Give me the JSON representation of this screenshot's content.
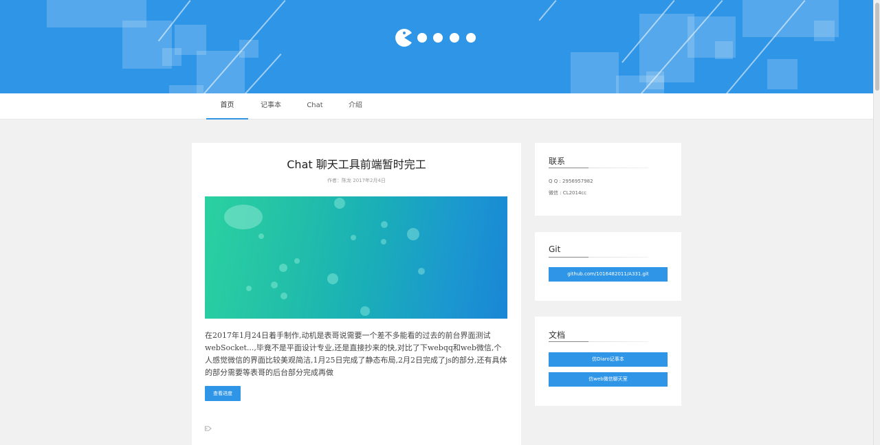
{
  "nav": {
    "items": [
      {
        "label": "首页",
        "active": true
      },
      {
        "label": "记事本",
        "active": false
      },
      {
        "label": "Chat",
        "active": false
      },
      {
        "label": "介绍",
        "active": false
      }
    ]
  },
  "post": {
    "title": "Chat 聊天工具前端暂时完工",
    "meta": "作者：陈龙 2017年2月4日",
    "body": "在2017年1月24日着手制作,动机是表哥说需要一个差不多能看的过去的前台界面测试 webSocket...,毕竟不是平面设计专业,还是直接抄来的快,对比了下webqq和web微信,个人感觉微信的界面比较美观简洁,1月25日完成了静态布局,2月2日完成了js的部分,还有具体的部分需要等表哥的后台部分完成再做",
    "read_more_label": "查看进度"
  },
  "sidebar": {
    "contact": {
      "title": "联系",
      "qq": "Q Q : 2956957982",
      "wechat": "微信 : CL2014cc"
    },
    "git": {
      "title": "Git",
      "link_label": "github.com/1016482011/A331.git"
    },
    "docs": {
      "title": "文档",
      "buttons": [
        "仿Diaro记事本",
        "仿web微信聊天室"
      ]
    }
  },
  "colors": {
    "accent": "#2f95e7",
    "background": "#f1f1f1"
  },
  "icons": {
    "logo": "pacman-logo-icon",
    "tag": "tag-icon"
  }
}
